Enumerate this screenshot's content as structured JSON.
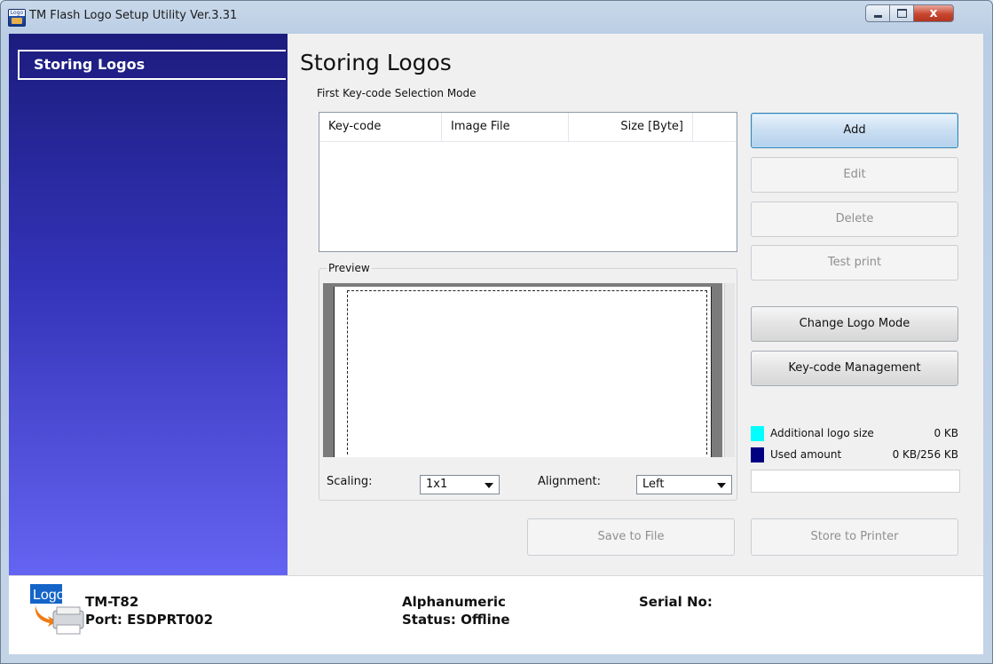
{
  "window": {
    "title": "TM Flash Logo Setup Utility Ver.3.31",
    "icon_text": "Logo",
    "controls": {
      "close": "x"
    }
  },
  "sidebar": {
    "items": [
      {
        "label": "Storing Logos"
      }
    ]
  },
  "main": {
    "title": "Storing Logos",
    "mode_label": "First Key-code Selection Mode",
    "table": {
      "columns": [
        "Key-code",
        "Image File",
        "Size [Byte]"
      ],
      "rows": []
    },
    "preview": {
      "label": "Preview",
      "scaling_label": "Scaling:",
      "scaling_value": "1x1",
      "alignment_label": "Alignment:",
      "alignment_value": "Left"
    },
    "buttons": {
      "add": "Add",
      "edit": "Edit",
      "delete": "Delete",
      "test_print": "Test print",
      "change_logo_mode": "Change Logo Mode",
      "keycode_management": "Key-code Management",
      "save_to_file": "Save to File",
      "store_to_printer": "Store to Printer"
    },
    "memory": {
      "additional_label": "Additional logo size",
      "additional_value": "0 KB",
      "additional_color": "#00ffff",
      "used_label": "Used amount",
      "used_value": "0 KB/256 KB",
      "used_color": "#000080"
    }
  },
  "status": {
    "logo_text": "Logo",
    "model": "TM-T82",
    "port": "Port: ESDPRT002",
    "mode": "Alphanumeric",
    "status": "Status: Offline",
    "serial_label": "Serial No:"
  }
}
